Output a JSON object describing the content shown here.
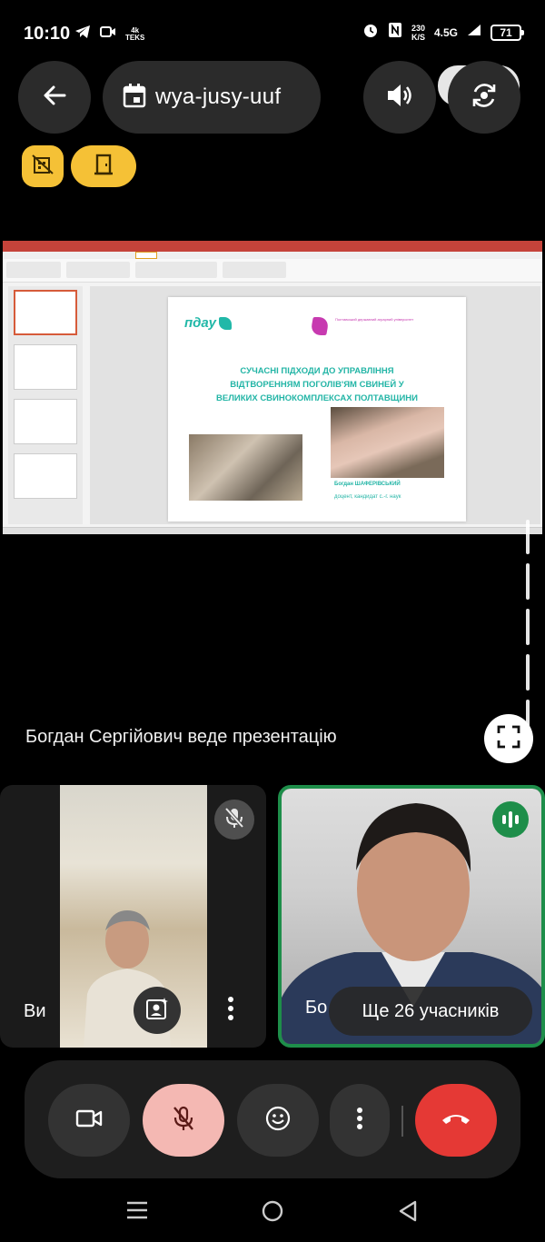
{
  "status_bar": {
    "time": "10:10",
    "left_small": "4k\nTEKS",
    "net_rate_top": "230",
    "net_rate_bottom": "K/S",
    "network": "4.5G",
    "battery": "71"
  },
  "top_bar": {
    "meeting_code": "wya-jusy-uuf",
    "icons": [
      "back-arrow-icon",
      "calendar-icon",
      "speaker-icon",
      "flip-camera-icon"
    ]
  },
  "badges": {
    "icons": [
      "no-building-icon",
      "door-icon"
    ],
    "colors": {
      "badge": "#f5c136"
    }
  },
  "presentation": {
    "logo_left": "пдау",
    "logo_right_text": "Полтавський державний аграрний університет",
    "title_lines": [
      "СУЧАСНІ ПІДХОДИ ДО УПРАВЛІННЯ",
      "ВІДТВОРЕННЯМ ПОГОЛІВ'ЯМ СВИНЕЙ У",
      "ВЕЛИКИХ СВИНОКОМПЛЕКСАХ ПОЛТАВЩИНИ"
    ],
    "author": "Богдан ШАФЕРІВСЬКИЙ",
    "author_role": "доцент, кандидат с.-г. наук",
    "accent_color": "#23b5a6"
  },
  "presenting_label": "Богдан Сергійович веде презентацію",
  "tiles": {
    "me_name": "Ви",
    "other_name": "Бо",
    "more_participants": "Ще 26 учасників",
    "speaking_color": "#1e8e4a"
  },
  "controls": {
    "icons": [
      "camera-icon",
      "mic-off-icon",
      "emoji-icon",
      "more-vert-icon",
      "call-end-icon"
    ],
    "colors": {
      "mic_off_bg": "#f4b8b3",
      "end_call_bg": "#e53935"
    }
  },
  "nav_bar": {
    "icons": [
      "recents-icon",
      "home-icon",
      "back-icon"
    ]
  }
}
